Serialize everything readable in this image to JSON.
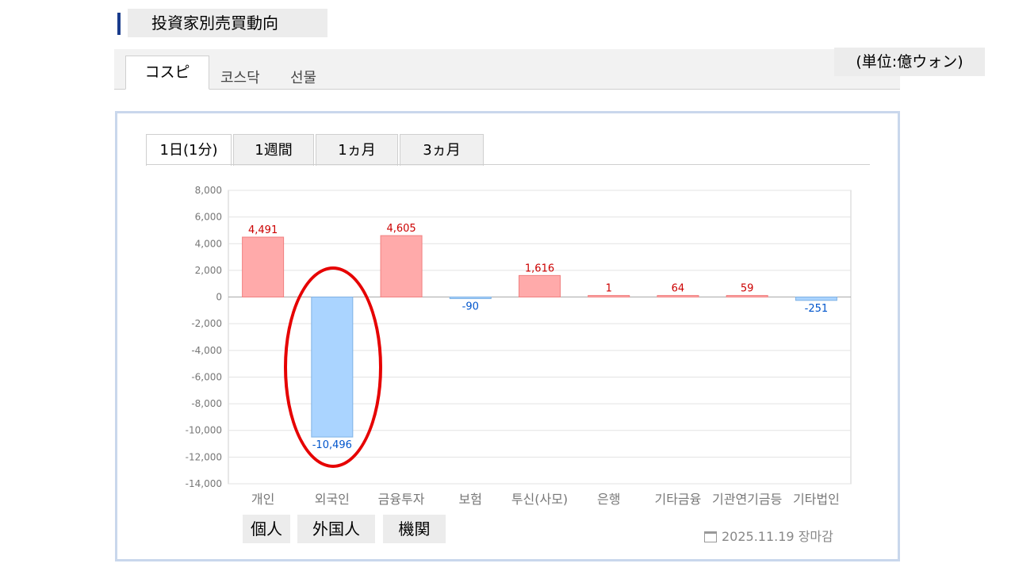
{
  "header": {
    "title": "投資家別売買動向"
  },
  "market_tabs": [
    {
      "label": "コスピ",
      "active": true
    },
    {
      "label": "코스닥",
      "active": false
    },
    {
      "label": "선물",
      "active": false
    }
  ],
  "unit_label": "(単位:億ウォン)",
  "period_tabs": [
    {
      "label": "1日(1分)",
      "active": true
    },
    {
      "label": "1週間",
      "active": false
    },
    {
      "label": "1ヵ月",
      "active": false
    },
    {
      "label": "3ヵ月",
      "active": false
    }
  ],
  "date_stamp": "2025.11.19 장마감",
  "gloss_labels": [
    "個人",
    "外国人",
    "機関"
  ],
  "chart_data": {
    "type": "bar",
    "categories": [
      "개인",
      "외국인",
      "금융투자",
      "보험",
      "투신(사모)",
      "은행",
      "기타금융",
      "기관연기금등",
      "기타법인"
    ],
    "values": [
      4491,
      -10496,
      4605,
      -90,
      1616,
      1,
      64,
      59,
      -251
    ],
    "value_labels": [
      "4,491",
      "-10,496",
      "4,605",
      "-90",
      "1,616",
      "1",
      "64",
      "59",
      "-251"
    ],
    "ylim": [
      -14000,
      8000
    ],
    "yticks": [
      8000,
      6000,
      4000,
      2000,
      0,
      -2000,
      -4000,
      -6000,
      -8000,
      -10000,
      -12000,
      -14000
    ],
    "ytick_labels": [
      "8,000",
      "6,000",
      "4,000",
      "2,000",
      "0",
      "-2,000",
      "-4,000",
      "-6,000",
      "-8,000",
      "-10,000",
      "-12,000",
      "-14,000"
    ],
    "grid": true,
    "colors": {
      "positive_fill": "#ffaaaa",
      "positive_stroke": "#f08080",
      "positive_label": "#cc0000",
      "negative_fill": "#aad4ff",
      "negative_stroke": "#7fb2e5",
      "negative_label": "#0055cc"
    },
    "highlight": {
      "category": "외국인",
      "color": "#e60000"
    }
  }
}
